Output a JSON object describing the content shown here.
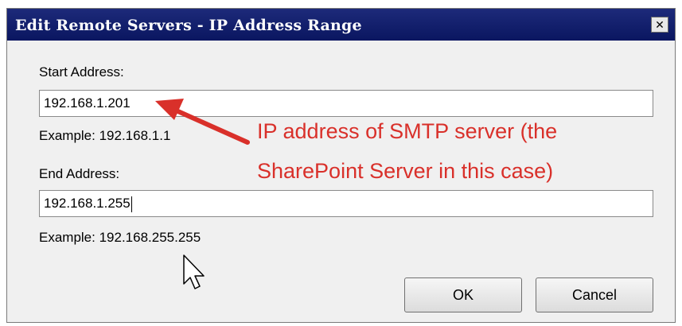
{
  "window": {
    "title": "Edit Remote Servers - IP Address Range",
    "close_glyph": "✕"
  },
  "start": {
    "label": "Start Address:",
    "value": "192.168.1.201",
    "example": "Example: 192.168.1.1"
  },
  "end": {
    "label": "End Address:",
    "value": "192.168.1.255",
    "example": "Example: 192.168.255.255"
  },
  "annotation": {
    "line1": "IP address of SMTP server (the",
    "line2": "SharePoint Server in this case)",
    "color": "#d9302a"
  },
  "buttons": {
    "ok": "OK",
    "cancel": "Cancel"
  },
  "icons": {
    "close": "close-icon",
    "arrow": "red-arrow-icon",
    "cursor": "mouse-pointer-icon"
  }
}
